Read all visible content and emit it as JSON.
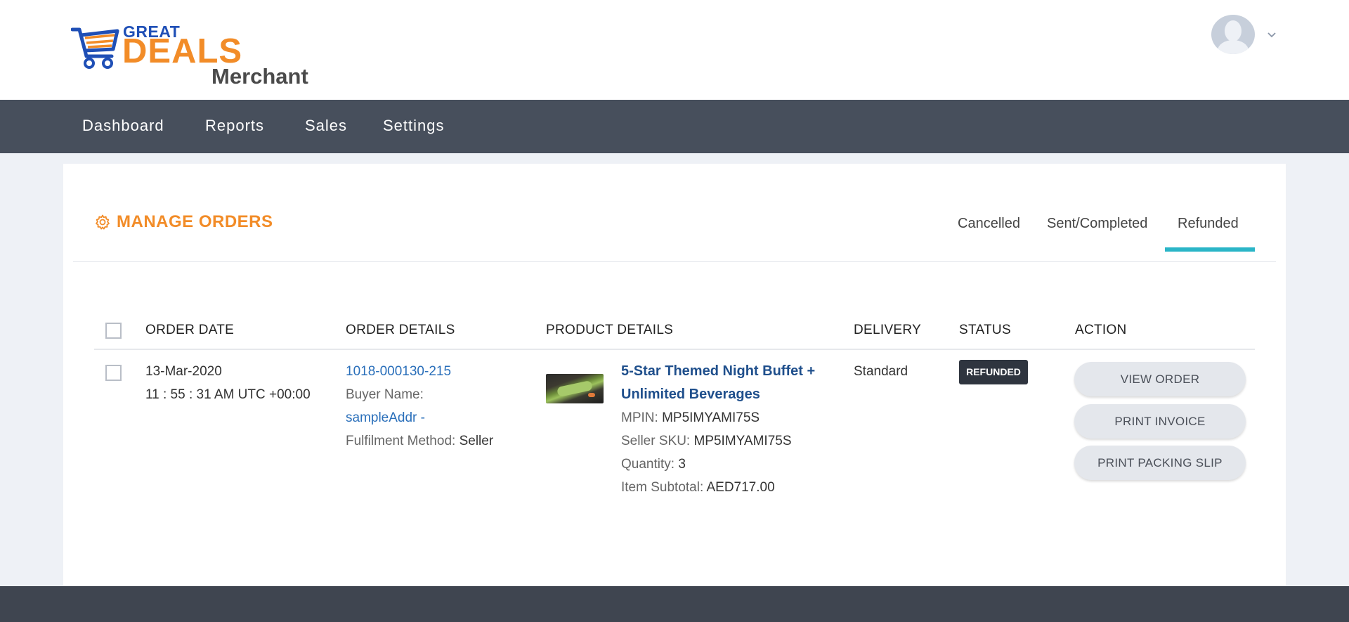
{
  "brand": {
    "great": "GREAT",
    "deals": "DEALS",
    "merchant": "Merchant"
  },
  "user": {
    "avatar_icon": "user-avatar-icon",
    "menu_icon": "chevron-down-icon"
  },
  "nav": {
    "items": [
      {
        "label": "Dashboard"
      },
      {
        "label": "Reports"
      },
      {
        "label": "Sales"
      },
      {
        "label": "Settings"
      }
    ]
  },
  "page": {
    "title": "MANAGE ORDERS",
    "title_icon": "gear-icon"
  },
  "tabs": [
    {
      "label": "Cancelled",
      "active": false
    },
    {
      "label": "Sent/Completed",
      "active": false
    },
    {
      "label": "Refunded",
      "active": true
    }
  ],
  "table": {
    "headers": {
      "order_date": "ORDER DATE",
      "order_details": "ORDER DETAILS",
      "product_details": "PRODUCT DETAILS",
      "delivery": "DELIVERY",
      "status": "STATUS",
      "action": "ACTION"
    },
    "rows": [
      {
        "date": "13-Mar-2020",
        "time": "11 : 55 : 31 AM UTC +00:00",
        "order_id": "1018-000130-215",
        "buyer_label": "Buyer Name:",
        "buyer_name": "sampleAddr -",
        "fulfilment_label": "Fulfilment Method:",
        "fulfilment_value": "Seller",
        "product_title": "5-Star Themed Night Buffet + Unlimited Beverages",
        "mpin_label": "MPIN:",
        "mpin_value": "MP5IMYAMI75S",
        "sku_label": "Seller SKU:",
        "sku_value": "MP5IMYAMI75S",
        "quantity_label": "Quantity:",
        "quantity_value": "3",
        "subtotal_label": "Item Subtotal:",
        "subtotal_value": "AED717.00",
        "delivery": "Standard",
        "status": "REFUNDED",
        "actions": {
          "view": "VIEW ORDER",
          "invoice": "PRINT INVOICE",
          "packing": "PRINT PACKING SLIP"
        }
      }
    ]
  },
  "colors": {
    "accent": "#f28c28",
    "navbar": "#474f5c",
    "tab_underline": "#2ab5c7",
    "link": "#2a6fba",
    "product_link": "#1f4f8c",
    "badge": "#2f353f"
  }
}
